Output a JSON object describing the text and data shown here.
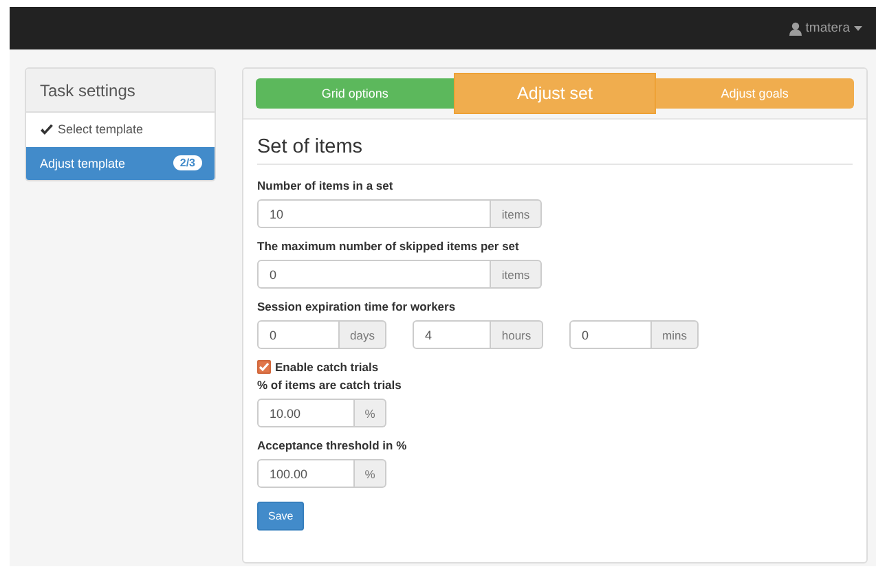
{
  "navbar": {
    "user": "tmatera"
  },
  "sidebar": {
    "title": "Task settings",
    "items": [
      {
        "label": "Select template",
        "done": true,
        "selected": false
      },
      {
        "label": "Adjust template",
        "done": false,
        "selected": true,
        "badge": "2/3"
      }
    ]
  },
  "steps": [
    {
      "label": "Grid options",
      "kind": "done"
    },
    {
      "label": "Adjust set",
      "kind": "current"
    },
    {
      "label": "Adjust goals",
      "kind": "pending"
    }
  ],
  "form": {
    "title": "Set of items",
    "groups": [
      {
        "kind": "wide",
        "label": "Number of items in a set",
        "inputs": [
          {
            "value": "10",
            "unit": "items"
          }
        ]
      },
      {
        "kind": "wide",
        "label": "The maximum number of skipped items per set",
        "inputs": [
          {
            "value": "0",
            "unit": "items"
          }
        ]
      },
      {
        "kind": "triple",
        "label": "Session expiration time for workers",
        "inputs": [
          {
            "value": "0",
            "unit": "days"
          },
          {
            "value": "4",
            "unit": "hours"
          },
          {
            "value": "0",
            "unit": "mins"
          }
        ]
      },
      {
        "kind": "checkbox",
        "label": "Enable catch trials",
        "checked": true
      },
      {
        "kind": "small",
        "label": "% of items are catch trials",
        "inputs": [
          {
            "value": "10.00",
            "unit": "%"
          }
        ]
      },
      {
        "kind": "small",
        "label": "Acceptance threshold in %",
        "inputs": [
          {
            "value": "100.00",
            "unit": "%"
          }
        ]
      }
    ],
    "submit": "Save"
  }
}
